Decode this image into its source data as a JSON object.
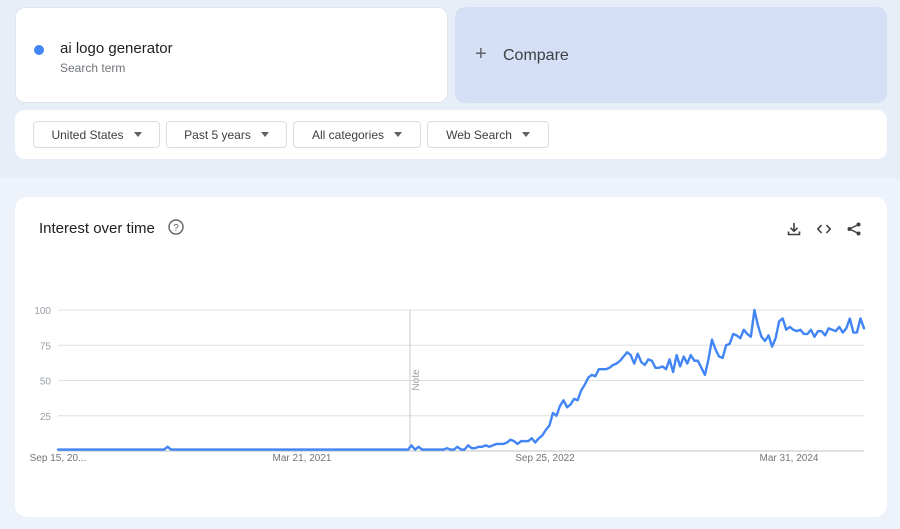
{
  "search_term": {
    "label": "ai logo generator",
    "sublabel": "Search term",
    "color": "#4285f4"
  },
  "compare": {
    "label": "Compare",
    "icon": "plus-icon"
  },
  "filters": [
    {
      "label": "United States",
      "icon": "caret-down-icon"
    },
    {
      "label": "Past 5 years",
      "icon": "caret-down-icon"
    },
    {
      "label": "All categories",
      "icon": "caret-down-icon"
    },
    {
      "label": "Web Search",
      "icon": "caret-down-icon"
    }
  ],
  "widget": {
    "title": "Interest over time",
    "help_icon": "help-circle-icon",
    "actions": [
      "download-icon",
      "embed-code-icon",
      "share-icon"
    ],
    "note_label": "Note"
  },
  "chart_data": {
    "type": "line",
    "title": "",
    "xlabel": "",
    "ylabel": "",
    "ylim": [
      0,
      100
    ],
    "yticks": [
      100,
      75,
      50,
      25
    ],
    "x_tick_labels": [
      "Sep 15, 20...",
      "Mar 21, 2021",
      "Sep 25, 2022",
      "Mar 31, 2024"
    ],
    "grid": true,
    "series": [
      {
        "color": "#4285f4",
        "values": [
          1,
          1,
          1,
          1,
          1,
          1,
          1,
          1,
          1,
          1,
          1,
          1,
          1,
          1,
          1,
          1,
          1,
          1,
          1,
          1,
          1,
          1,
          1,
          1,
          1,
          1,
          1,
          1,
          1,
          1,
          1,
          3,
          1,
          1,
          1,
          1,
          1,
          1,
          1,
          1,
          1,
          1,
          1,
          1,
          1,
          1,
          1,
          1,
          1,
          1,
          1,
          1,
          1,
          1,
          1,
          1,
          1,
          1,
          1,
          1,
          1,
          1,
          1,
          1,
          1,
          1,
          1,
          1,
          1,
          1,
          1,
          1,
          1,
          1,
          1,
          1,
          1,
          1,
          1,
          1,
          1,
          1,
          1,
          1,
          1,
          1,
          1,
          1,
          1,
          1,
          1,
          1,
          1,
          1,
          1,
          1,
          1,
          1,
          1,
          1,
          4,
          1,
          3,
          1,
          1,
          1,
          1,
          1,
          1,
          1,
          2,
          1,
          1,
          3,
          1,
          1,
          4,
          2,
          2,
          3,
          3,
          4,
          3,
          4,
          5,
          5,
          5,
          6,
          8,
          7,
          5,
          7,
          7,
          7,
          9,
          6,
          9,
          11,
          15,
          18,
          27,
          25,
          32,
          36,
          31,
          33,
          37,
          36,
          43,
          47,
          52,
          54,
          53,
          58,
          58,
          58,
          59,
          61,
          62,
          64,
          67,
          70,
          68,
          62,
          69,
          63,
          61,
          65,
          64,
          59,
          59,
          60,
          58,
          65,
          56,
          68,
          60,
          67,
          62,
          68,
          64,
          64,
          59,
          54,
          65,
          79,
          72,
          67,
          66,
          75,
          76,
          83,
          82,
          80,
          86,
          83,
          81,
          100,
          89,
          81,
          78,
          82,
          74,
          80,
          92,
          94,
          86,
          88,
          86,
          85,
          86,
          83,
          83,
          86,
          81,
          85,
          85,
          82,
          87,
          86,
          85,
          88,
          84,
          87,
          94,
          84,
          84,
          94,
          87
        ]
      }
    ],
    "note_position_index": 100
  }
}
